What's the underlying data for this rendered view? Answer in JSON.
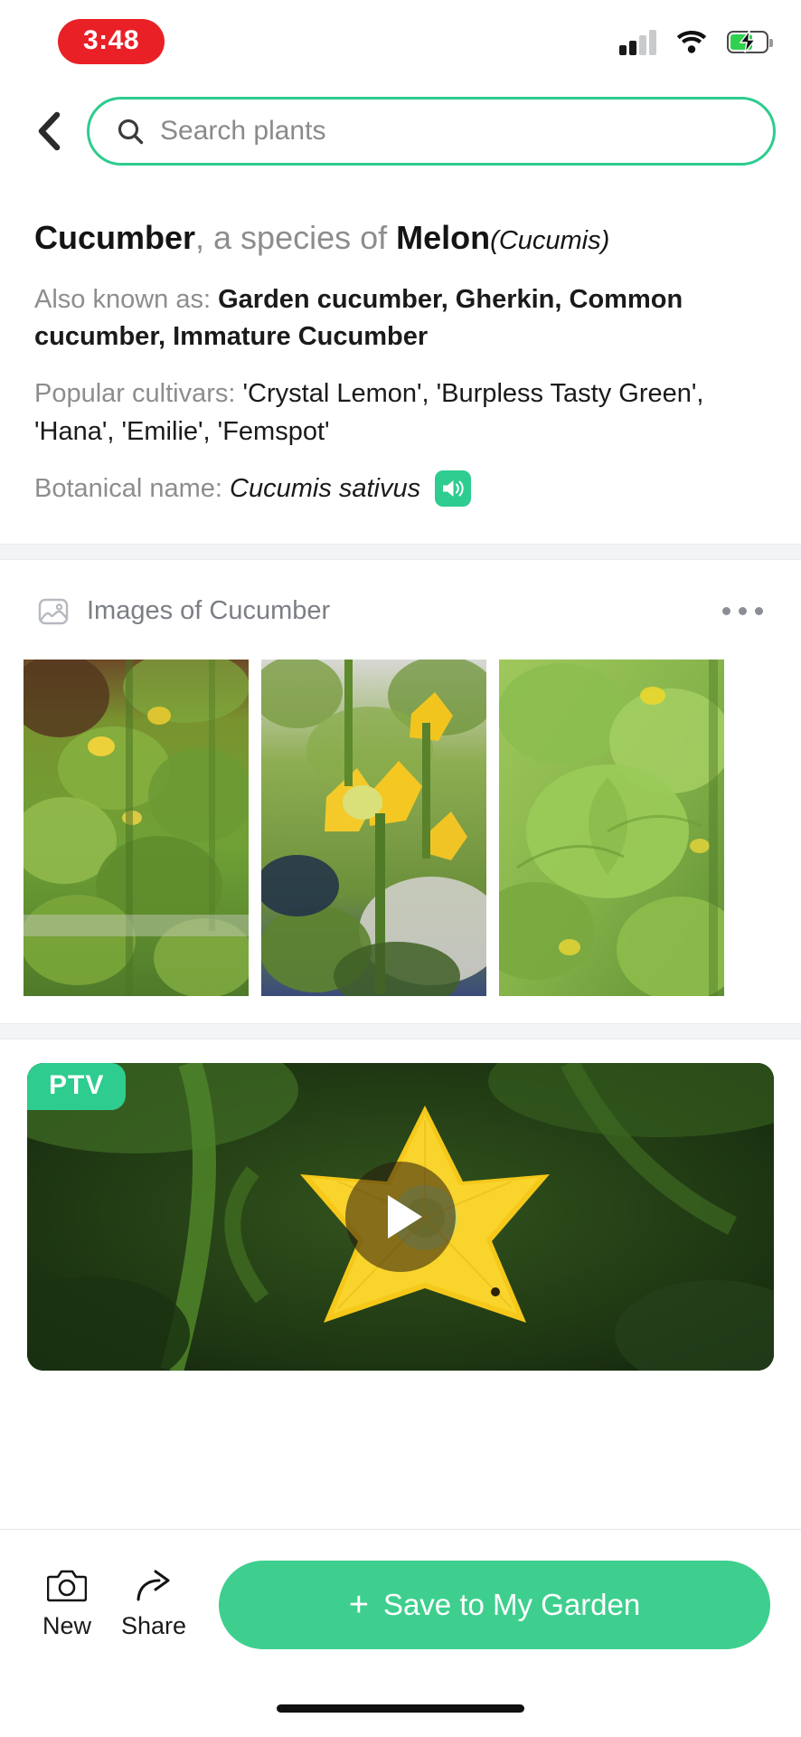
{
  "status_bar": {
    "time": "3:48",
    "time_pill_color": "#EA2027",
    "signal_icon": "cellular-signal-icon",
    "wifi_icon": "wifi-icon",
    "battery_icon": "battery-charging-icon",
    "battery_level_percent": 62
  },
  "header": {
    "back_icon": "chevron-left-icon",
    "search_icon": "search-icon",
    "search_value": "",
    "search_placeholder": "Search plants",
    "accent_color": "#2ecc8f"
  },
  "plant": {
    "common_name": "Cucumber",
    "species_of_prefix": ", a species of ",
    "genus_common": "Melon",
    "genus_latin": "(Cucumis)",
    "also_known_label": "Also known as: ",
    "also_known_value": "Garden cucumber, Gherkin, Common cucumber, Immature Cucumber",
    "cultivars_label": "Popular cultivars: ",
    "cultivars_value": "'Crystal Lemon', 'Burpless Tasty Green', 'Hana', 'Emilie', 'Femspot'",
    "botanical_label": "Botanical name: ",
    "botanical_value": "Cucumis sativus",
    "speaker_icon": "speaker-sound-icon"
  },
  "images_section": {
    "header_icon": "image-icon",
    "header_title": "Images of Cucumber",
    "more_icon": "more-horizontal-icon",
    "thumbnails": [
      {
        "name": "cucumber-plant-photo-1",
        "alt": "Cucumber vine with yellow flowers on trellis"
      },
      {
        "name": "cucumber-plant-photo-2",
        "alt": "Cucumber plant with large yellow blossom in pot"
      },
      {
        "name": "cucumber-plant-photo-3",
        "alt": "Close-up of green cucumber leaves"
      }
    ]
  },
  "video_section": {
    "badge": "PTV",
    "badge_color": "#2ecc8f",
    "play_icon": "play-icon",
    "alt": "Yellow cucumber flower close-up video thumbnail"
  },
  "bottom_bar": {
    "actions": [
      {
        "icon": "camera-icon",
        "label": "New"
      },
      {
        "icon": "share-icon",
        "label": "Share"
      }
    ],
    "save_plus": "+",
    "save_label": "Save to My Garden",
    "save_color": "#3ecf8e"
  },
  "home_indicator": "home-indicator-bar"
}
